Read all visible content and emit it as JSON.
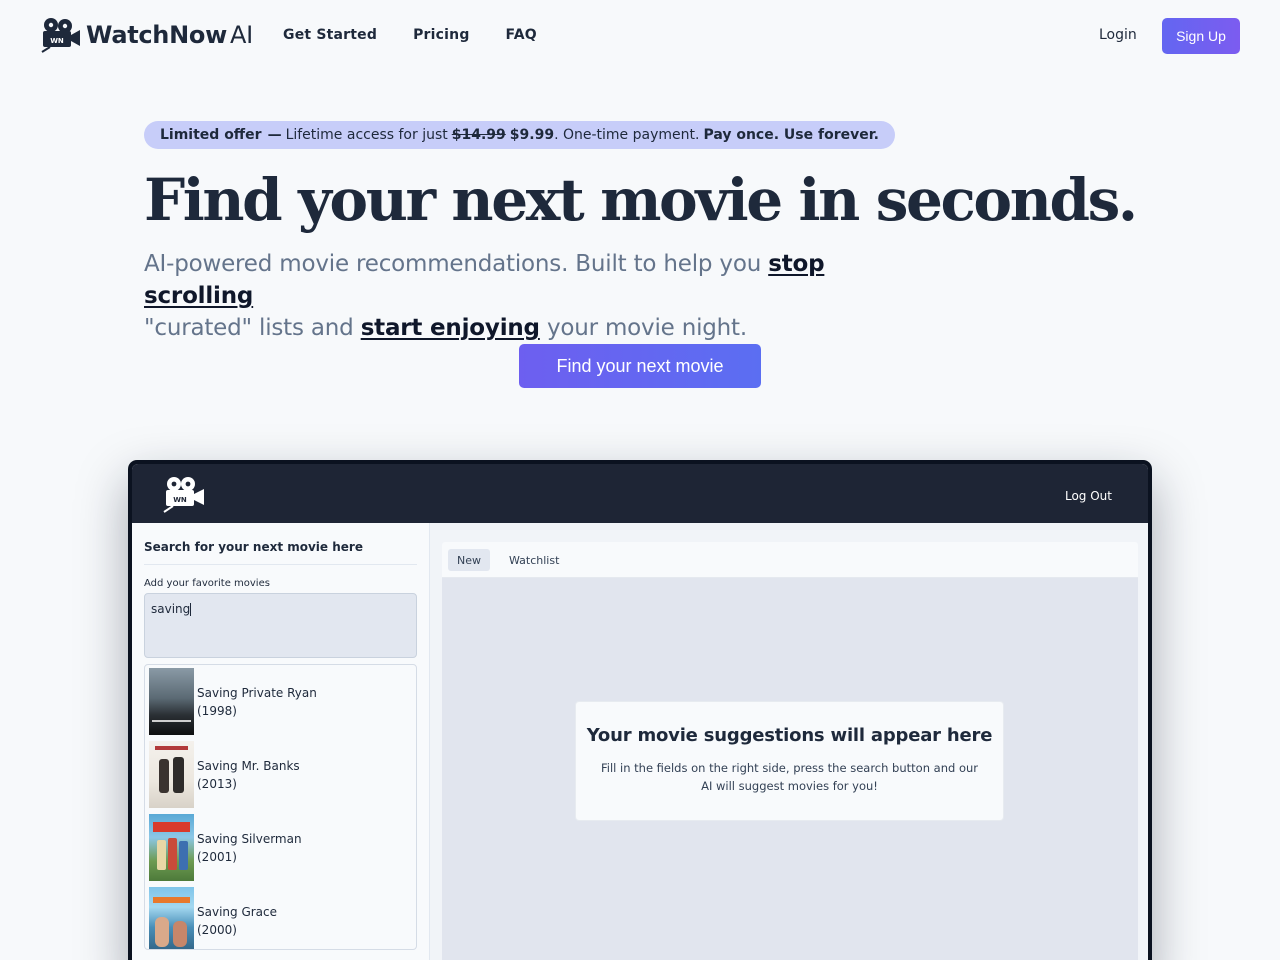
{
  "nav": {
    "logo_main": "WatchNow",
    "logo_suffix": "AI",
    "logo_badge": "WN",
    "links": [
      "Get Started",
      "Pricing",
      "FAQ"
    ],
    "login": "Login",
    "signup": "Sign Up"
  },
  "hero": {
    "offer_label": "Limited offer",
    "offer_dash": "—",
    "offer_text": "Lifetime access for just",
    "offer_old_price": "$14.99",
    "offer_new_price": "$9.99",
    "offer_payment": ". One-time payment.",
    "offer_tagline": "Pay once. Use forever.",
    "headline": "Find your next movie in seconds.",
    "sub_part1": "AI-powered movie recommendations. Built to help you",
    "sub_em1": "stop scrolling",
    "sub_part2": "\"curated\" lists and",
    "sub_em2": "start enjoying",
    "sub_part3": "your movie night.",
    "cta": "Find your next movie"
  },
  "app": {
    "logo_badge": "WN",
    "logout": "Log Out",
    "sidebar": {
      "title": "Search for your next movie here",
      "fav_label": "Add your favorite movies",
      "fav_value": "saving",
      "suggestions": [
        {
          "title": "Saving Private Ryan",
          "year": "(1998)"
        },
        {
          "title": "Saving Mr. Banks",
          "year": "(2013)"
        },
        {
          "title": "Saving Silverman",
          "year": "(2001)"
        },
        {
          "title": "Saving Grace",
          "year": "(2000)"
        }
      ]
    },
    "tabs": [
      "New",
      "Watchlist"
    ],
    "empty": {
      "title": "Your movie suggestions will appear here",
      "description": "Fill in the fields on the right side, press the search button and our AI will suggest movies for you!"
    }
  },
  "colors": {
    "accent": "#6366f1",
    "offer_bg": "#c7cdf9",
    "app_header": "#1e2535"
  }
}
